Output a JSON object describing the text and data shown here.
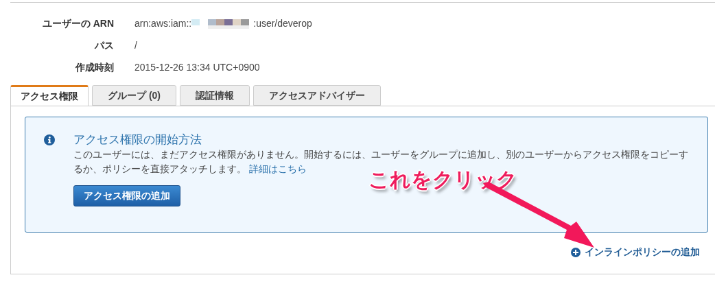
{
  "details": [
    {
      "label": "ユーザーの ARN",
      "kind": "arn",
      "value_prefix": "arn:aws:iam::",
      "value_suffix": ":user/deverop"
    },
    {
      "label": "パス",
      "kind": "text",
      "value": "/"
    },
    {
      "label": "作成時刻",
      "kind": "text",
      "value": "2015-12-26 13:34 UTC+0900"
    }
  ],
  "tabs": [
    {
      "label": "アクセス権限",
      "selected": true
    },
    {
      "label": "グループ (0)",
      "selected": false
    },
    {
      "label": "認証情報",
      "selected": false
    },
    {
      "label": "アクセスアドバイザー",
      "selected": false
    }
  ],
  "info_box": {
    "title": "アクセス権限の開始方法",
    "text": "このユーザーには、まだアクセス権限がありません。開始するには、ユーザーをグループに追加し、別のユーザーからアクセス権限をコピーするか、ポリシーを直接アタッチします。",
    "link": "詳細はこちら",
    "button": "アクセス権限の追加"
  },
  "inline_policy_link": "インラインポリシーの追加",
  "annotation": {
    "text": "これをクリック"
  }
}
